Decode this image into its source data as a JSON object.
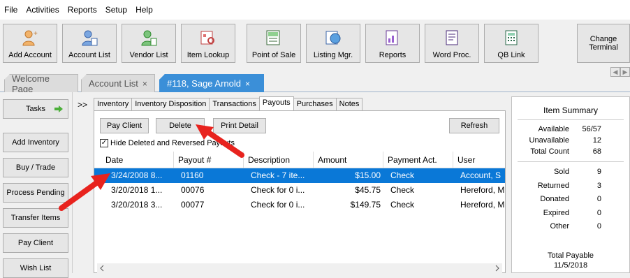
{
  "menu": [
    "File",
    "Activities",
    "Reports",
    "Setup",
    "Help"
  ],
  "toolbar": {
    "add_account": "Add Account",
    "account_list": "Account List",
    "vendor_list": "Vendor List",
    "item_lookup": "Item Lookup",
    "point_of_sale": "Point of Sale",
    "listing_mgr": "Listing Mgr.",
    "reports": "Reports",
    "word_proc": "Word Proc.",
    "qb_link": "QB Link",
    "change_terminal_1": "Change",
    "change_terminal_2": "Terminal"
  },
  "tabs": {
    "welcome": "Welcome Page",
    "account_list": "Account List",
    "account": "#118, Sage Arnold",
    "close": "×"
  },
  "sidebar": {
    "tasks": "Tasks",
    "add_inventory": "Add Inventory",
    "buy_trade": "Buy / Trade",
    "process_pending": "Process Pending",
    "transfer_items": "Transfer Items",
    "pay_client": "Pay Client",
    "wish_list": "Wish List"
  },
  "expand_label": ">>",
  "subtabs": [
    "Inventory",
    "Inventory Disposition",
    "Transactions",
    "Payouts",
    "Purchases",
    "Notes"
  ],
  "payouts": {
    "pay_client": "Pay Client",
    "delete": "Delete",
    "print_detail": "Print Detail",
    "refresh": "Refresh",
    "hide_deleted": "Hide Deleted and Reversed Payouts",
    "hide_deleted_checked": "✓",
    "columns": [
      "Date",
      "Payout #",
      "Description",
      "Amount",
      "Payment Act.",
      "User"
    ],
    "rows": [
      {
        "date": "3/24/2008 8...",
        "payout": "01160",
        "description": "Check - 7 ite...",
        "amount": "$15.00",
        "payment": "Check",
        "user": "Account, S"
      },
      {
        "date": "3/20/2018 1...",
        "payout": "00076",
        "description": "Check for 0 i...",
        "amount": "$45.75",
        "payment": "Check",
        "user": "Hereford, M"
      },
      {
        "date": "3/20/2018 3...",
        "payout": "00077",
        "description": "Check for 0 i...",
        "amount": "$149.75",
        "payment": "Check",
        "user": "Hereford, M"
      }
    ]
  },
  "summary": {
    "title": "Item Summary",
    "available_label": "Available",
    "available": "56/57",
    "unavailable_label": "Unavailable",
    "unavailable": "12",
    "total_count_label": "Total Count",
    "total_count": "68",
    "sold_label": "Sold",
    "sold": "9",
    "returned_label": "Returned",
    "returned": "3",
    "donated_label": "Donated",
    "donated": "0",
    "expired_label": "Expired",
    "expired": "0",
    "other_label": "Other",
    "other": "0",
    "total_payable_label": "Total Payable",
    "total_payable_date": "11/5/2018"
  },
  "colors": {
    "accent": "#3b8fd8",
    "selection": "#0a78d7",
    "arrow": "#e8231e"
  }
}
